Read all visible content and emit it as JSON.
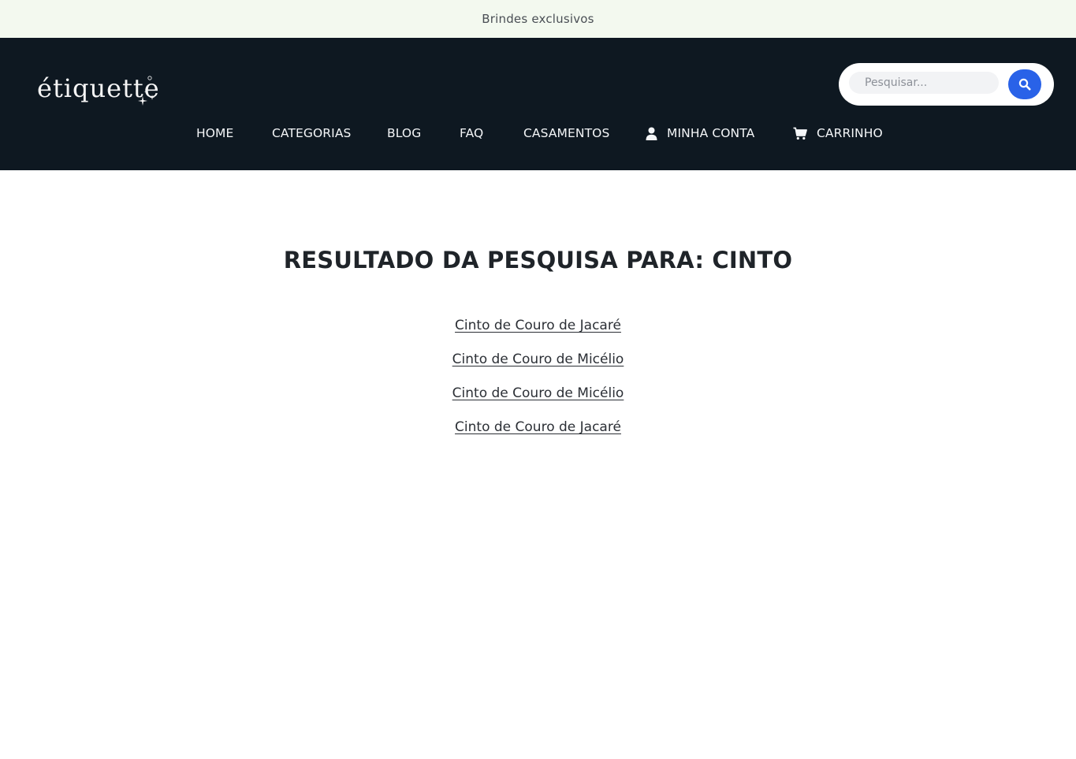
{
  "topbar": {
    "text": "Brindes exclusivos"
  },
  "header": {
    "logo_text": "étiquette",
    "search": {
      "placeholder": "Pesquisar...",
      "value": ""
    },
    "nav": [
      {
        "label": "HOME",
        "icon": ""
      },
      {
        "label": "CATEGORIAS",
        "icon": ""
      },
      {
        "label": "BLOG",
        "icon": ""
      },
      {
        "label": "FAQ",
        "icon": ""
      },
      {
        "label": "CASAMENTOS",
        "icon": ""
      },
      {
        "label": "MINHA CONTA",
        "icon": "user-icon"
      },
      {
        "label": "CARRINHO",
        "icon": "cart-icon"
      }
    ]
  },
  "main": {
    "title": "RESULTADO DA PESQUISA PARA: CINTO",
    "results": [
      "Cinto de Couro de Jacaré",
      "Cinto de Couro de Micélio",
      "Cinto de Couro de Micélio",
      "Cinto de Couro de Jacaré"
    ]
  },
  "colors": {
    "topbar_bg": "#f3f9ef",
    "header_bg": "#0e1821",
    "accent": "#2962e8"
  }
}
